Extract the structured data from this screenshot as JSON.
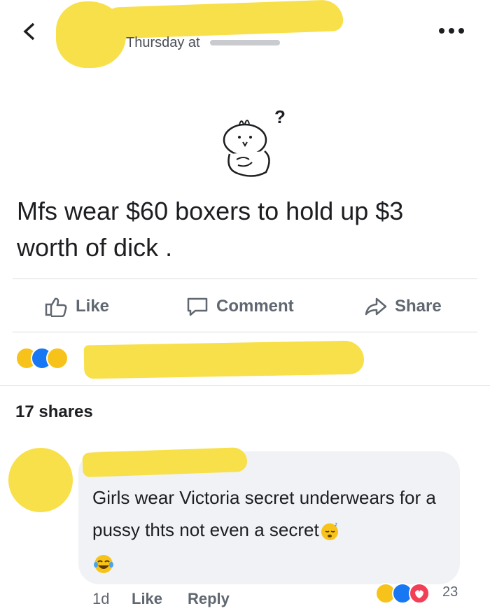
{
  "header": {
    "back_icon": "chevron-left-icon",
    "more_icon": "more-dots-icon",
    "timestamp": "Thursday at"
  },
  "post": {
    "text": "Mfs wear $60 boxers to hold up $3 worth of dick .",
    "sticker": "bunny-confused-sticker"
  },
  "actions": {
    "like": "Like",
    "comment": "Comment",
    "share": "Share"
  },
  "reactions": [
    "haha",
    "like",
    "sad"
  ],
  "shares": "17 shares",
  "comment": {
    "text": "Girls wear Victoria secret underwears for a pussy thts not even a secret",
    "emojis": [
      "sleepy-face",
      "tears-of-joy"
    ],
    "time": "1d",
    "like": "Like",
    "reply": "Reply",
    "reactions": [
      "haha",
      "like",
      "love"
    ],
    "reaction_count": "23"
  },
  "colors": {
    "redaction": "#f7e04a",
    "like_blue": "#1877f2",
    "love_red": "#f33e58",
    "bubble": "#f0f2f5"
  }
}
